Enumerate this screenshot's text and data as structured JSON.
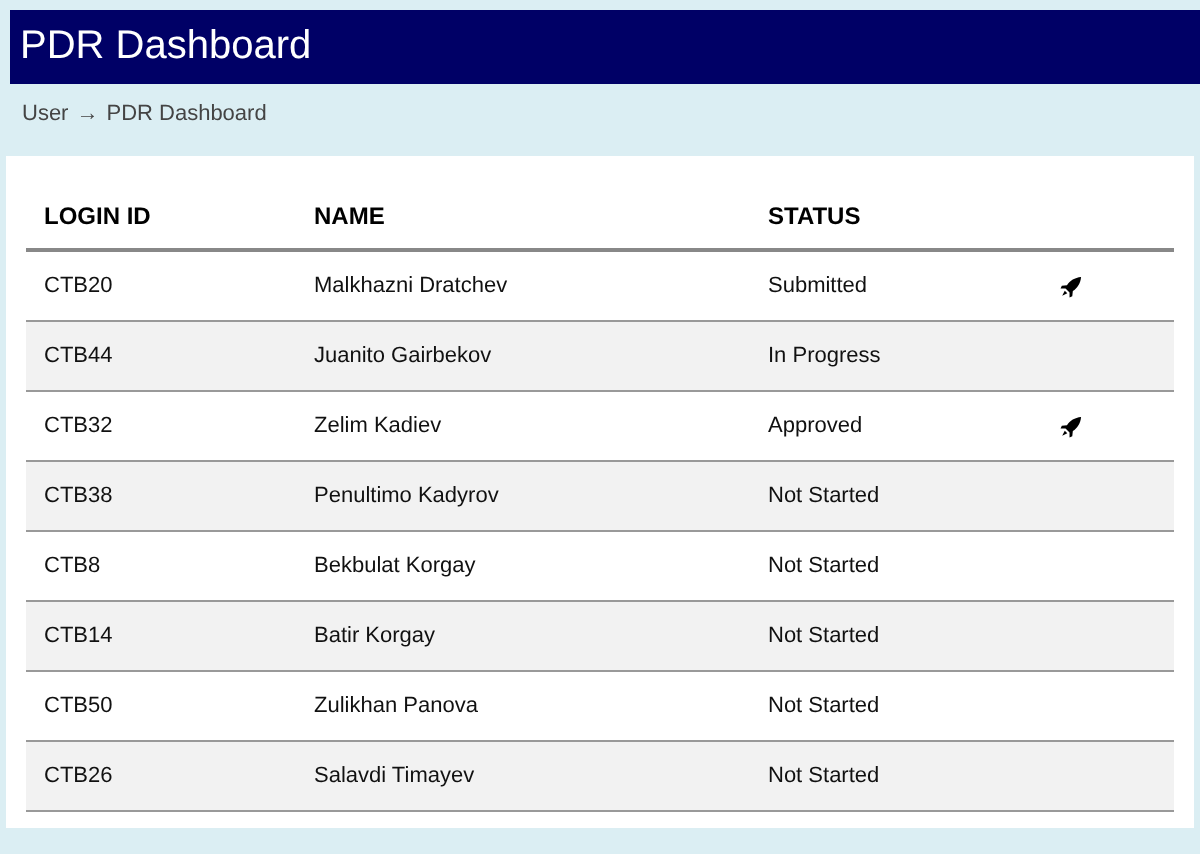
{
  "header": {
    "title": "PDR Dashboard"
  },
  "breadcrumb": {
    "items": [
      "User",
      "PDR Dashboard"
    ],
    "separator": "→"
  },
  "table": {
    "columns": [
      "LOGIN ID",
      "NAME",
      "STATUS"
    ],
    "rows": [
      {
        "login_id": "CTB20",
        "name": "Malkhazni Dratchev",
        "status": "Submitted",
        "action_icon": true
      },
      {
        "login_id": "CTB44",
        "name": "Juanito Gairbekov",
        "status": "In Progress",
        "action_icon": false
      },
      {
        "login_id": "CTB32",
        "name": "Zelim Kadiev",
        "status": "Approved",
        "action_icon": true
      },
      {
        "login_id": "CTB38",
        "name": "Penultimo Kadyrov",
        "status": "Not Started",
        "action_icon": false
      },
      {
        "login_id": "CTB8",
        "name": "Bekbulat Korgay",
        "status": "Not Started",
        "action_icon": false
      },
      {
        "login_id": "CTB14",
        "name": "Batir Korgay",
        "status": "Not Started",
        "action_icon": false
      },
      {
        "login_id": "CTB50",
        "name": "Zulikhan Panova",
        "status": "Not Started",
        "action_icon": false
      },
      {
        "login_id": "CTB26",
        "name": "Salavdi Timayev",
        "status": "Not Started",
        "action_icon": false
      }
    ]
  }
}
